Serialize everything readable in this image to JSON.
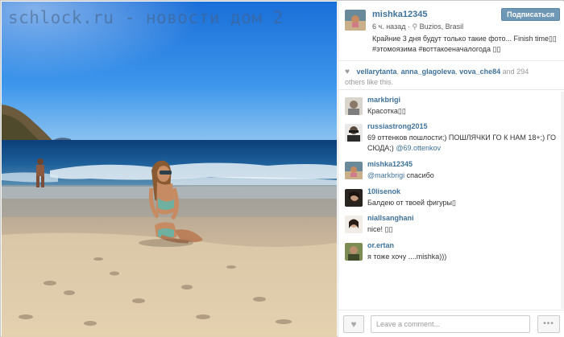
{
  "watermark": "schlock.ru - новости дом 2",
  "post": {
    "username": "mishka12345",
    "follow_label": "Подписаться",
    "time": "6 ч. назад",
    "location": "Buzios, Brasil",
    "caption": "Крайние 3 дня будут только такие фото... Finish time▯▯ #этомоязима #воттакоеначалогода ▯▯"
  },
  "likes": {
    "users": [
      "vellarytanta",
      "anna_glagoleva",
      "vova_che84"
    ],
    "and_text": "and 294",
    "suffix": "others like this."
  },
  "comments": [
    {
      "user": "markbrigi",
      "text": "Красотка▯▯"
    },
    {
      "user": "russiastrong2015",
      "text": "69 оттенков пошлости;) ПОШЛЯЧКИ ГО К НАМ 18+;) ГО СЮДА;)",
      "mention": "@69.ottenkov"
    },
    {
      "user": "mishka12345",
      "mention": "@markbrigi",
      "text": "спасибо"
    },
    {
      "user": "10lisenok",
      "text": "Балдею от твоей фигуры▯"
    },
    {
      "user": "niallsanghani",
      "text": "nice! ▯▯"
    },
    {
      "user": "or.ertan",
      "text": "я тоже хочу ....mishka)))"
    }
  ],
  "footer": {
    "comment_placeholder": "Leave a comment...",
    "more_label": "•••"
  },
  "icons": {
    "like": "heart-icon",
    "location": "pin-icon",
    "more": "ellipsis-icon"
  }
}
